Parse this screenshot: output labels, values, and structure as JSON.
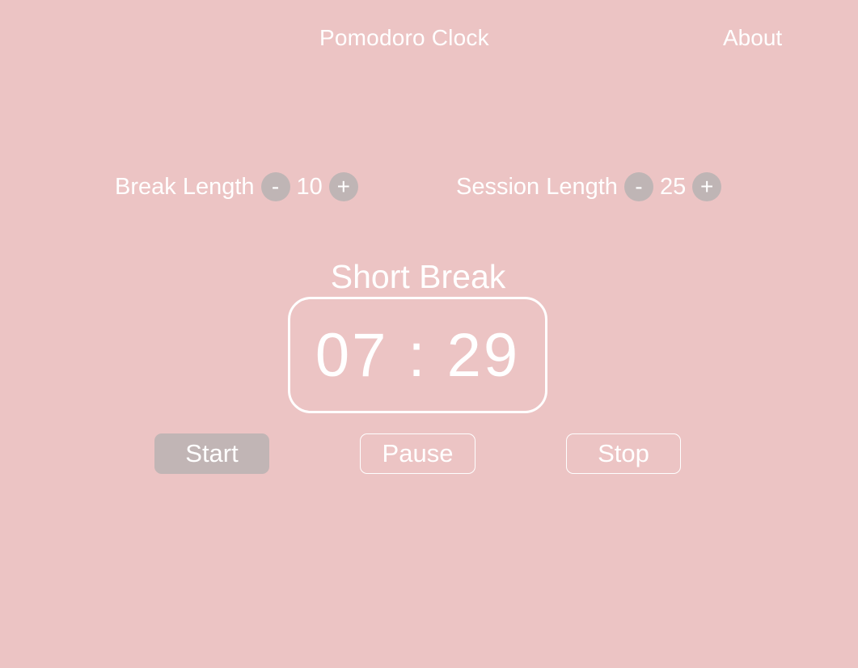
{
  "header": {
    "title": "Pomodoro Clock",
    "about_label": "About"
  },
  "settings": {
    "break": {
      "label": "Break Length",
      "decrement_label": "-",
      "value": "10",
      "increment_label": "+"
    },
    "session": {
      "label": "Session Length",
      "decrement_label": "-",
      "value": "25",
      "increment_label": "+"
    }
  },
  "timer": {
    "mode_label": "Short Break",
    "minutes": "07",
    "separator": ":",
    "seconds": "29"
  },
  "controls": {
    "start_label": "Start",
    "pause_label": "Pause",
    "stop_label": "Stop"
  },
  "colors": {
    "background": "#ecc4c4",
    "text": "#ffffff",
    "button_fill": "#bfb5b5"
  }
}
